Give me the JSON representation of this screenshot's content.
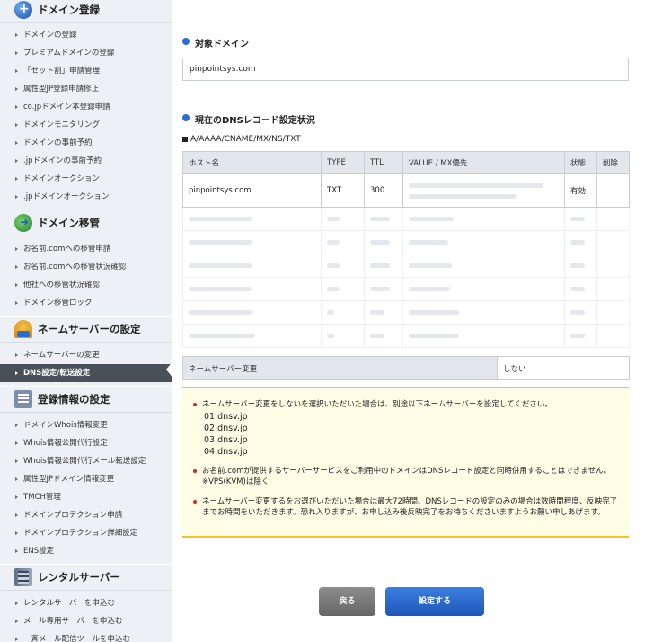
{
  "sidebar": {
    "sections": [
      {
        "title": "ドメイン登録",
        "icon": "globe-plus-icon",
        "items": [
          "ドメインの登録",
          "プレミアムドメインの登録",
          "「セット割」申請管理",
          "属性型JP登録申請修正",
          "co.jpドメイン本登録申請",
          "ドメインモニタリング",
          "ドメインの事前予約",
          ".jpドメインの事前予約",
          "ドメインオークション",
          ".jpドメインオークション"
        ]
      },
      {
        "title": "ドメイン移管",
        "icon": "domain-transfer-icon",
        "items": [
          "お名前.comへの移管申請",
          "お名前.comへの移管状況確認",
          "他社への移管状況確認",
          "ドメイン移管ロック"
        ]
      },
      {
        "title": "ネームサーバーの設定",
        "icon": "nameserver-icon",
        "items": [
          "ネームサーバーの変更",
          "DNS設定/転送設定"
        ]
      },
      {
        "title": "登録情報の設定",
        "icon": "registration-info-icon",
        "items": [
          "ドメインWhois情報変更",
          "Whois情報公開代行設定",
          "Whois情報公開代行メール転送設定",
          "属性型JPドメイン情報変更",
          "TMCH管理",
          "ドメインプロテクション申請",
          "ドメインプロテクション詳細設定",
          "ENS設定"
        ]
      },
      {
        "title": "レンタルサーバー",
        "icon": "rental-server-icon",
        "items": [
          "レンタルサーバーを申込む",
          "メール専用サーバーを申込む",
          "一斉メール配信ツールを申込む"
        ]
      }
    ],
    "active_item": "DNS設定/転送設定"
  },
  "main": {
    "target_title": "対象ドメイン",
    "target_domain": "pinpointsys.com",
    "records_title": "現在のDNSレコード設定状況",
    "record_types": "A/AAAA/CNAME/MX/NS/TXT",
    "table": {
      "headers": [
        "ホスト名",
        "TYPE",
        "TTL",
        "VALUE / MX優先",
        "状態",
        "削除"
      ],
      "row": {
        "host": "pinpointsys.com",
        "type": "TXT",
        "ttl": "300",
        "value": "",
        "status": "有効",
        "delete": ""
      },
      "blurred_row_count": 6
    },
    "nameserver_label": "ネームサーバー変更",
    "nameserver_value": "しない",
    "notice": {
      "item1": "ネームサーバー変更をしないを選択いただいた場合は、別途以下ネームサーバーを設定してください。",
      "nameservers": [
        "01.dnsv.jp",
        "02.dnsv.jp",
        "03.dnsv.jp",
        "04.dnsv.jp"
      ],
      "item2_line1": "お名前.comが提供するサーバーサービスをご利用中のドメインはDNSレコード設定と同時併用することはできません。",
      "item2_line2": "※VPS(KVM)は除く",
      "item3": "ネームサーバー変更するをお選びいただいた場合は最大72時間、DNSレコードの設定のみの場合は数時間程度、反映完了までお時間をいただきます。恐れ入りますが、お申し込み後反映完了をお待ちくださいますようお願い申しあげます。"
    },
    "back_label": "戻る",
    "submit_label": "設定する"
  },
  "colors": {
    "accent": "#1d57b8",
    "sidebar_bg": "#edf1f6",
    "active_bg": "#4a5058",
    "notice_border": "#f5c225",
    "notice_bg": "#fffde6",
    "bullet": "#d9261c"
  }
}
